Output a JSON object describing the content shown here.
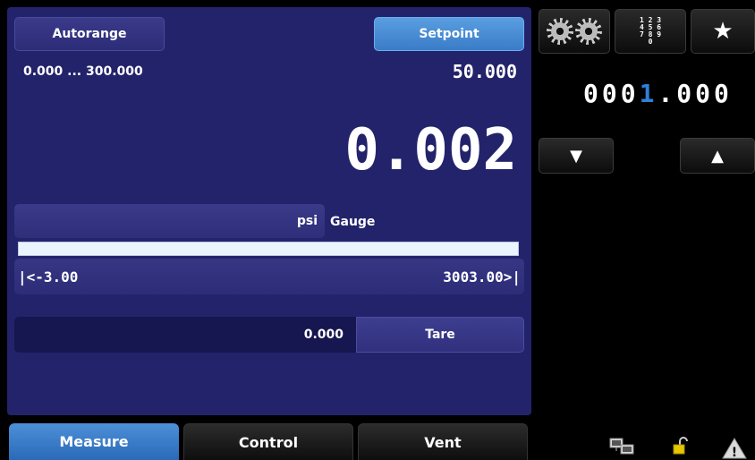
{
  "main": {
    "autorange_label": "Autorange",
    "setpoint_label": "Setpoint",
    "range_text": "0.000 ... 300.000",
    "setpoint_value": "50.000",
    "reading": "0.002",
    "unit": "psi",
    "mode": "Gauge",
    "range_min": "|<-3.00",
    "range_max": "3003.00>|",
    "tare_value": "0.000",
    "tare_label": "Tare"
  },
  "side": {
    "keypad_rows": [
      "1 2 3",
      "4 5 6",
      "7 8 9",
      "0"
    ],
    "counter_prefix": "000",
    "counter_highlight": "1",
    "counter_suffix": ".000",
    "down_arrow": "▼",
    "up_arrow": "▲",
    "star": "★"
  },
  "tabs": [
    {
      "label": "Measure"
    },
    {
      "label": "Control"
    },
    {
      "label": "Vent"
    }
  ],
  "status": {
    "warning_glyph": "!"
  },
  "colors": {
    "panel": "#23236b",
    "active_tab": "#3a7cc8",
    "counter_highlight": "#2f7fd8"
  }
}
